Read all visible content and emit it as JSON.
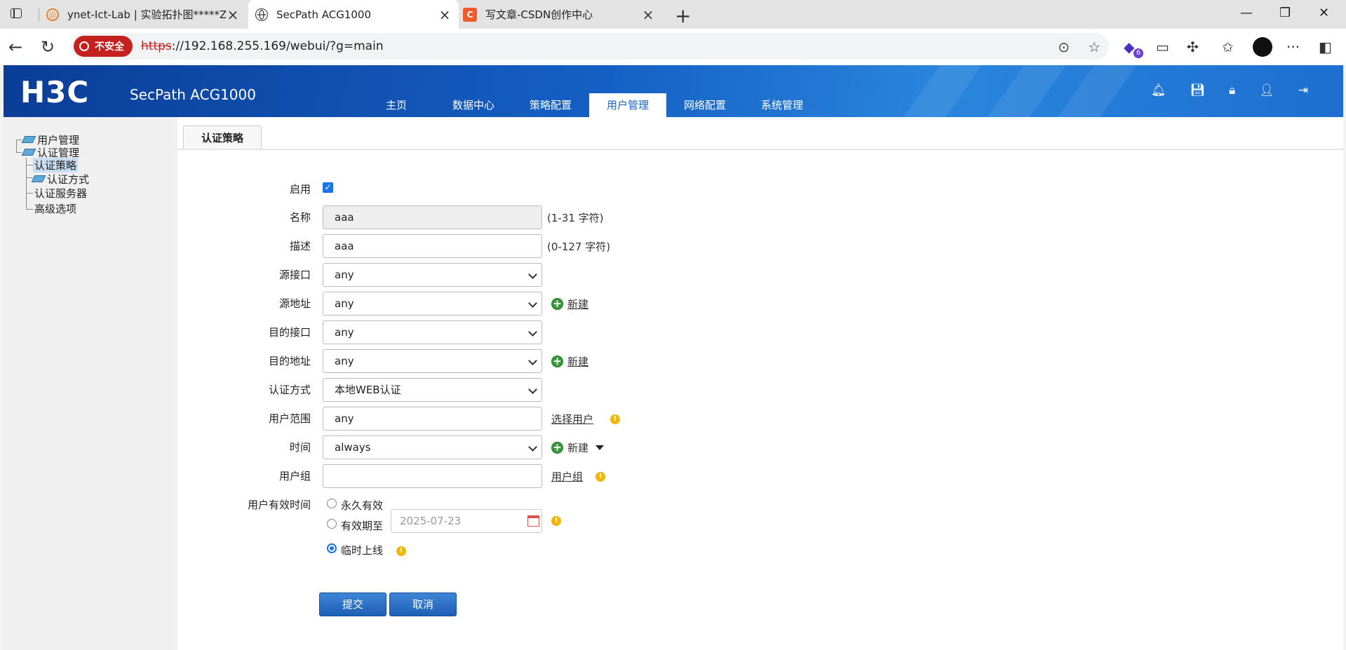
{
  "browser": {
    "tabs": [
      {
        "title": "ynet-Ict-Lab | 实验拓扑图*****Zh",
        "favicon": "ict-lab-icon"
      },
      {
        "title": "SecPath ACG1000",
        "favicon": "globe-icon"
      },
      {
        "title": "写文章-CSDN创作中心",
        "favicon": "csdn-icon",
        "favicon_letter": "C"
      }
    ],
    "security_label": "不安全",
    "url_scheme": "https",
    "url_rest": "://192.168.255.169/webui/?g=main",
    "extension_badge": "6"
  },
  "app": {
    "logo": "H3C",
    "product": "SecPath ACG1000",
    "menu": [
      "主页",
      "数据中心",
      "策略配置",
      "用户管理",
      "网络配置",
      "系统管理"
    ],
    "active_menu": "用户管理"
  },
  "sidebar": {
    "root": "用户管理",
    "group": "认证管理",
    "items": [
      "认证策略",
      "认证方式",
      "认证服务器",
      "高级选项"
    ],
    "selected": "认证策略"
  },
  "content": {
    "tab": "认证策略",
    "form": {
      "enable_label": "启用",
      "enabled": true,
      "name_label": "名称",
      "name_value": "aaa",
      "name_hint": "(1-31 字符)",
      "desc_label": "描述",
      "desc_value": "aaa",
      "desc_hint": "(0-127 字符)",
      "src_if_label": "源接口",
      "src_if_value": "any",
      "src_addr_label": "源地址",
      "src_addr_value": "any",
      "dst_if_label": "目的接口",
      "dst_if_value": "any",
      "dst_addr_label": "目的地址",
      "dst_addr_value": "any",
      "auth_method_label": "认证方式",
      "auth_method_value": "本地WEB认证",
      "user_scope_label": "用户范围",
      "user_scope_value": "any",
      "select_user_link": "选择用户",
      "time_label": "时间",
      "time_value": "always",
      "user_group_label": "用户组",
      "user_group_value": "",
      "user_group_link": "用户组",
      "validity_label": "用户有效时间",
      "validity_options": [
        "永久有效",
        "有效期至",
        "临时上线"
      ],
      "validity_selected": "临时上线",
      "expiry_date": "2025-07-23",
      "new_link": "新建",
      "submit": "提交",
      "cancel": "取消"
    }
  },
  "colors": {
    "header_blue": "#1560c4",
    "active_menu_text": "#1a63c7",
    "insecure_red": "#c5221f",
    "button_blue": "#1d5fb5"
  }
}
